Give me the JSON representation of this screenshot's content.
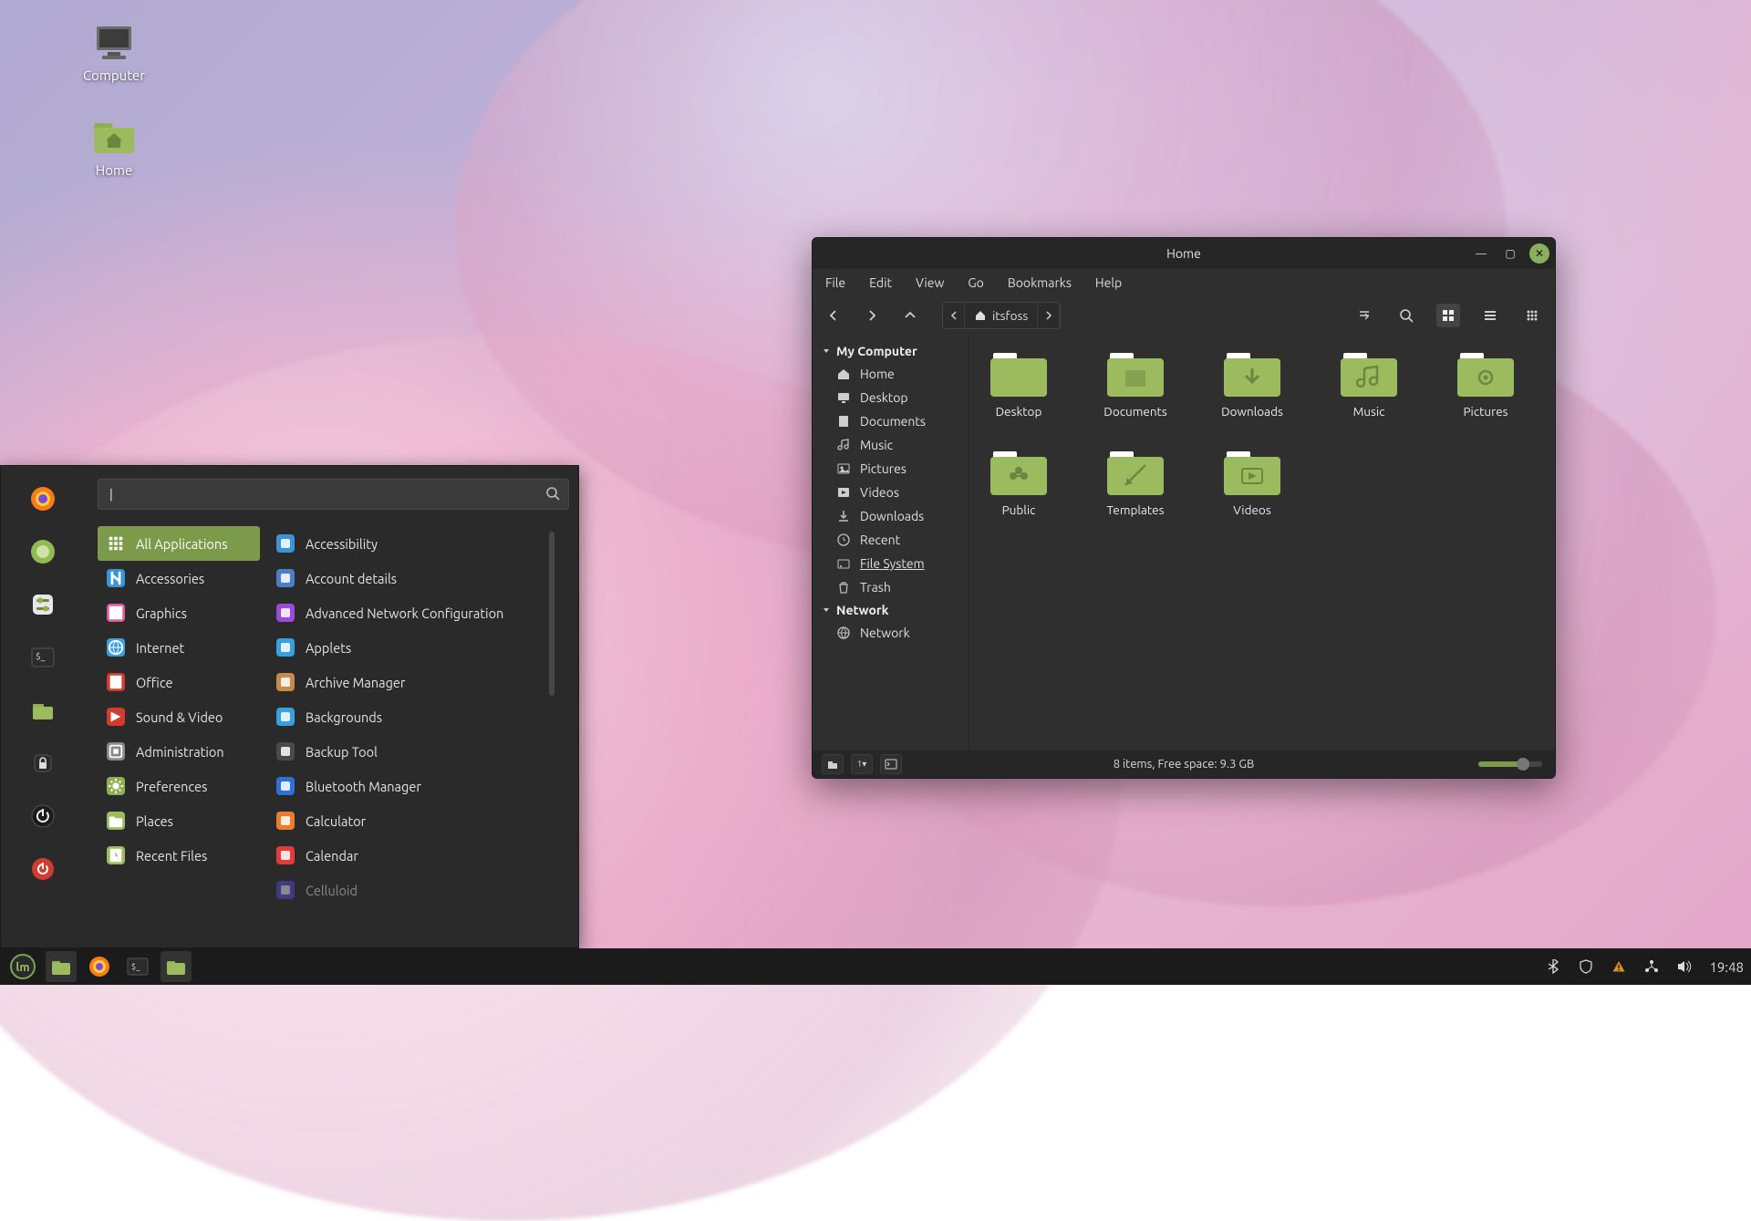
{
  "desktop": {
    "icons": [
      {
        "name": "Computer"
      },
      {
        "name": "Home"
      }
    ]
  },
  "menu": {
    "search_placeholder": "",
    "categories": [
      "All Applications",
      "Accessories",
      "Graphics",
      "Internet",
      "Office",
      "Sound & Video",
      "Administration",
      "Preferences",
      "Places",
      "Recent Files"
    ],
    "selected_category_index": 0,
    "apps": [
      "Accessibility",
      "Account details",
      "Advanced Network Configuration",
      "Applets",
      "Archive Manager",
      "Backgrounds",
      "Backup Tool",
      "Bluetooth Manager",
      "Calculator",
      "Calendar",
      "Celluloid"
    ],
    "dimmed_app_index": 10
  },
  "filemanager": {
    "title": "Home",
    "menubar": [
      "File",
      "Edit",
      "View",
      "Go",
      "Bookmarks",
      "Help"
    ],
    "path_user": "itsfoss",
    "sidebar": {
      "sections": [
        {
          "header": "My Computer",
          "items": [
            "Home",
            "Desktop",
            "Documents",
            "Music",
            "Pictures",
            "Videos",
            "Downloads",
            "Recent",
            "File System",
            "Trash"
          ],
          "selected_index": 8
        },
        {
          "header": "Network",
          "items": [
            "Network"
          ]
        }
      ]
    },
    "folders": [
      "Desktop",
      "Documents",
      "Downloads",
      "Music",
      "Pictures",
      "Public",
      "Templates",
      "Videos"
    ],
    "status": "8 items, Free space: 9.3 GB"
  },
  "taskbar": {
    "clock": "19:48"
  }
}
